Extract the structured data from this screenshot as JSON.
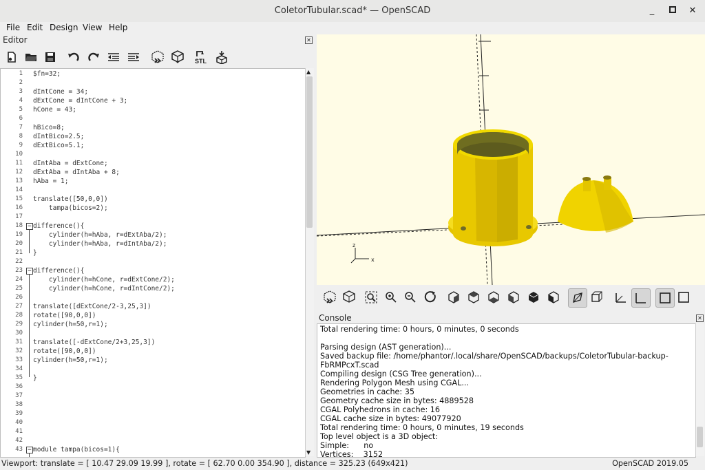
{
  "window": {
    "title": "ColetorTubular.scad* — OpenSCAD",
    "controls": [
      "_",
      "□",
      "✕"
    ]
  },
  "menu": [
    {
      "label": "File"
    },
    {
      "label": "Edit"
    },
    {
      "label": "Design"
    },
    {
      "label": "View"
    },
    {
      "label": "Help"
    }
  ],
  "editor": {
    "title": "Editor",
    "toolbar": [
      "new-icon",
      "open-icon",
      "save-icon",
      "undo-icon",
      "redo-icon",
      "unindent-icon",
      "indent-icon",
      "preview-icon",
      "render-icon",
      "export-stl-icon",
      "send-to-3d-print-icon"
    ],
    "stl_label": "STL",
    "lines": [
      {
        "n": "1",
        "t": "$fn=32;"
      },
      {
        "n": "2",
        "t": ""
      },
      {
        "n": "3",
        "t": "dIntCone = 34;"
      },
      {
        "n": "4",
        "t": "dExtCone = dIntCone + 3;"
      },
      {
        "n": "5",
        "t": "hCone = 43;"
      },
      {
        "n": "6",
        "t": ""
      },
      {
        "n": "7",
        "t": "hBico=8;"
      },
      {
        "n": "8",
        "t": "dIntBico=2.5;"
      },
      {
        "n": "9",
        "t": "dExtBico=5.1;"
      },
      {
        "n": "10",
        "t": ""
      },
      {
        "n": "11",
        "t": "dIntAba = dExtCone;"
      },
      {
        "n": "12",
        "t": "dExtAba = dIntAba + 8;"
      },
      {
        "n": "13",
        "t": "hAba = 1;"
      },
      {
        "n": "14",
        "t": ""
      },
      {
        "n": "15",
        "t": "translate([50,0,0])"
      },
      {
        "n": "16",
        "t": "    tampa(bicos=2);"
      },
      {
        "n": "17",
        "t": ""
      },
      {
        "n": "18",
        "t": "difference(){",
        "fold": "−"
      },
      {
        "n": "19",
        "t": "    cylinder(h=hAba, r=dExtAba/2);"
      },
      {
        "n": "20",
        "t": "    cylinder(h=hAba, r=dIntAba/2);"
      },
      {
        "n": "21",
        "t": "}"
      },
      {
        "n": "22",
        "t": ""
      },
      {
        "n": "23",
        "t": "difference(){",
        "fold": "−"
      },
      {
        "n": "24",
        "t": "    cylinder(h=hCone, r=dExtCone/2);"
      },
      {
        "n": "25",
        "t": "    cylinder(h=hCone, r=dIntCone/2);"
      },
      {
        "n": "26",
        "t": ""
      },
      {
        "n": "27",
        "t": "translate([dExtCone/2-3,25,3])"
      },
      {
        "n": "28",
        "t": "rotate([90,0,0])"
      },
      {
        "n": "29",
        "t": "cylinder(h=50,r=1);"
      },
      {
        "n": "30",
        "t": ""
      },
      {
        "n": "31",
        "t": "translate([-dExtCone/2+3,25,3])"
      },
      {
        "n": "32",
        "t": "rotate([90,0,0])"
      },
      {
        "n": "33",
        "t": "cylinder(h=50,r=1);"
      },
      {
        "n": "34",
        "t": ""
      },
      {
        "n": "35",
        "t": "}"
      },
      {
        "n": "36",
        "t": ""
      },
      {
        "n": "37",
        "t": ""
      },
      {
        "n": "38",
        "t": ""
      },
      {
        "n": "39",
        "t": ""
      },
      {
        "n": "40",
        "t": ""
      },
      {
        "n": "41",
        "t": ""
      },
      {
        "n": "42",
        "t": ""
      },
      {
        "n": "43",
        "t": "module tampa(bicos=1){",
        "fold": "−"
      }
    ]
  },
  "viewport_toolbar": [
    "preview-icon",
    "render-icon",
    "zoom-all-icon",
    "zoom-in-icon",
    "zoom-out-icon",
    "reset-view-icon",
    "view-right-icon",
    "view-top-icon",
    "view-bottom-icon",
    "view-left-icon",
    "view-front-icon",
    "view-back-icon",
    "view-diagonal-icon",
    "view-center-icon",
    "perspective-icon",
    "orthogonal-icon",
    "show-axes-icon",
    "show-scale-icon",
    "show-edges-icon"
  ],
  "viewport": {
    "axis_x": "x",
    "axis_z": "z",
    "scale_label": "10"
  },
  "console": {
    "title": "Console",
    "lines": [
      "Total rendering time: 0 hours, 0 minutes, 0 seconds",
      "",
      "Parsing design (AST generation)...",
      "Saved backup file: /home/phantor/.local/share/OpenSCAD/backups/ColetorTubular-backup-",
      "FbRMPcxT.scad",
      "Compiling design (CSG Tree generation)...",
      "Rendering Polygon Mesh using CGAL...",
      "Geometries in cache: 35",
      "Geometry cache size in bytes: 4889528",
      "CGAL Polyhedrons in cache: 16",
      "CGAL cache size in bytes: 49077920",
      "Total rendering time: 0 hours, 0 minutes, 19 seconds",
      "Top level object is a 3D object:",
      "Simple:      no",
      "Vertices:    3152"
    ]
  },
  "status": {
    "viewport": "Viewport: translate = [ 10.47 29.09 19.99 ], rotate = [ 62.70 0.00 354.90 ], distance = 325.23 (649x421)",
    "version": "OpenSCAD 2019.05"
  },
  "colors": {
    "model": "#f2d600",
    "viewport_bg": "#fffce6",
    "keyword": "#0000c8",
    "number": "#8b0000"
  }
}
